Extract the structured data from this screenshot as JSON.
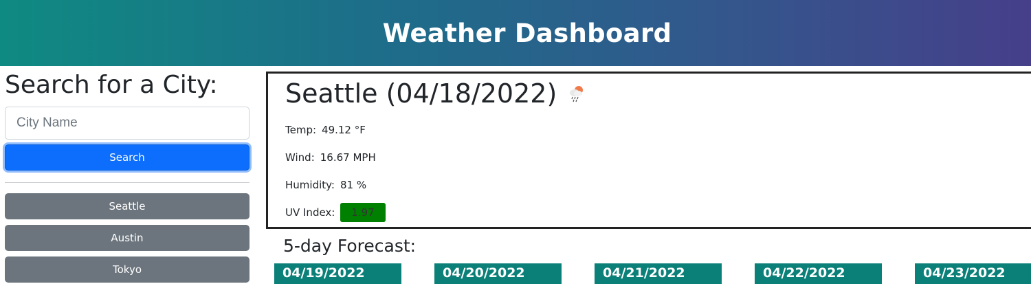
{
  "header": {
    "title": "Weather Dashboard"
  },
  "sidebar": {
    "heading": "Search for a City:",
    "search_placeholder": "City Name",
    "search_value": "",
    "search_button": "Search",
    "history": [
      "Seattle",
      "Austin",
      "Tokyo"
    ]
  },
  "current": {
    "title": "Seattle (04/18/2022)",
    "icon": "rain-cloud-icon",
    "temp_label": "Temp:",
    "temp_value": "49.12 °F",
    "wind_label": "Wind:",
    "wind_value": "16.67 MPH",
    "humidity_label": "Humidity:",
    "humidity_value": "81 %",
    "uv_label": "UV Index:",
    "uv_value": "1.97",
    "uv_color": "#008000"
  },
  "forecast": {
    "title": "5-day Forecast:",
    "days": [
      "04/19/2022",
      "04/20/2022",
      "04/21/2022",
      "04/22/2022",
      "04/23/2022"
    ]
  },
  "colors": {
    "header_gradient_start": "#0f8a82",
    "header_gradient_end": "#463f8a",
    "primary": "#0d6efd",
    "secondary": "#6c757d",
    "forecast_card": "#0b8079"
  }
}
